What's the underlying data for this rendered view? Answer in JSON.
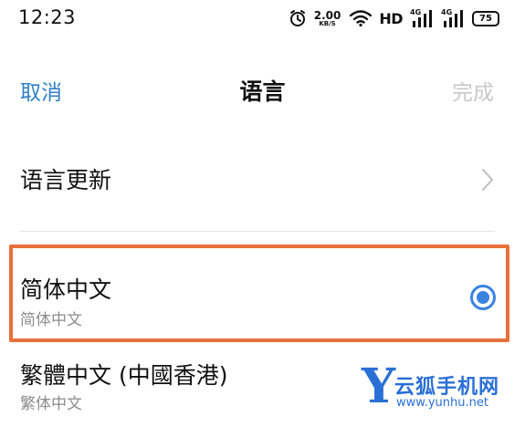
{
  "status_bar": {
    "time": "12:23",
    "net_speed_value": "2.00",
    "net_speed_unit": "KB/S",
    "hd_label": "HD",
    "signal_1_label": "4G",
    "signal_2_label": "4G",
    "battery_level": "75"
  },
  "header": {
    "cancel_label": "取消",
    "title": "语言",
    "done_label": "完成"
  },
  "update_row": {
    "label": "语言更新"
  },
  "languages": [
    {
      "title": "简体中文",
      "subtitle": "简体中文",
      "selected": true
    },
    {
      "title": "繁體中文 (中國香港)",
      "subtitle": "繁体中文",
      "selected": false
    }
  ],
  "watermark": {
    "letter": "Y",
    "name": "云狐手机网",
    "url": "www.yunhu.net"
  },
  "colors": {
    "accent": "#2f7fc9",
    "radio": "#3a82e0",
    "highlight_border": "#e8703a",
    "disabled_text": "#c9c9c9",
    "watermark": "#2a6fd6"
  }
}
